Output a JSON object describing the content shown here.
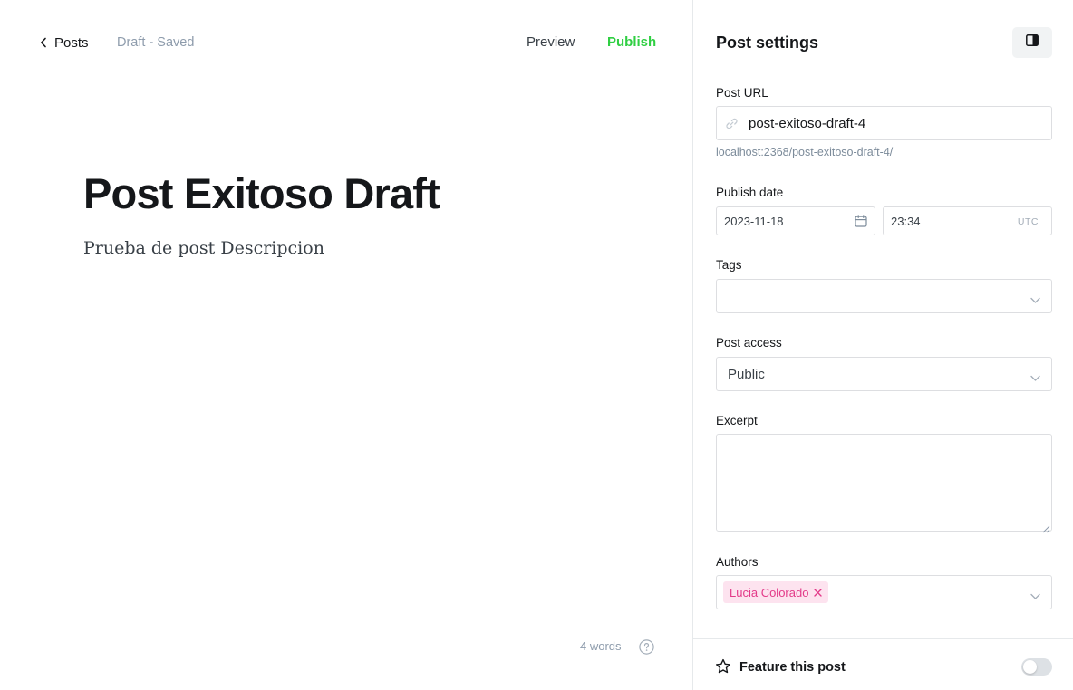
{
  "editor": {
    "back_label": "Posts",
    "status": "Draft - Saved",
    "preview_label": "Preview",
    "publish_label": "Publish",
    "title": "Post Exitoso Draft",
    "excerpt": "Prueba de post Descripcion",
    "word_count": "4 words"
  },
  "sidebar": {
    "title": "Post settings",
    "url": {
      "label": "Post URL",
      "value": "post-exitoso-draft-4",
      "hint": "localhost:2368/post-exitoso-draft-4/"
    },
    "publish_date": {
      "label": "Publish date",
      "date": "2023-11-18",
      "time": "23:34",
      "timezone": "UTC"
    },
    "tags": {
      "label": "Tags"
    },
    "access": {
      "label": "Post access",
      "value": "Public"
    },
    "excerpt": {
      "label": "Excerpt",
      "value": ""
    },
    "authors": {
      "label": "Authors",
      "items": [
        "Lucia Colorado"
      ]
    },
    "feature": {
      "label": "Feature this post",
      "enabled": false
    }
  },
  "colors": {
    "publish": "#30cf43",
    "author_chip_bg": "#fde3ef",
    "author_chip_text": "#e33a89"
  },
  "icons": [
    "chevron-left-icon",
    "sidebar-toggle-icon",
    "link-icon",
    "calendar-icon",
    "chevron-down-icon",
    "close-icon",
    "star-icon",
    "help-icon"
  ]
}
